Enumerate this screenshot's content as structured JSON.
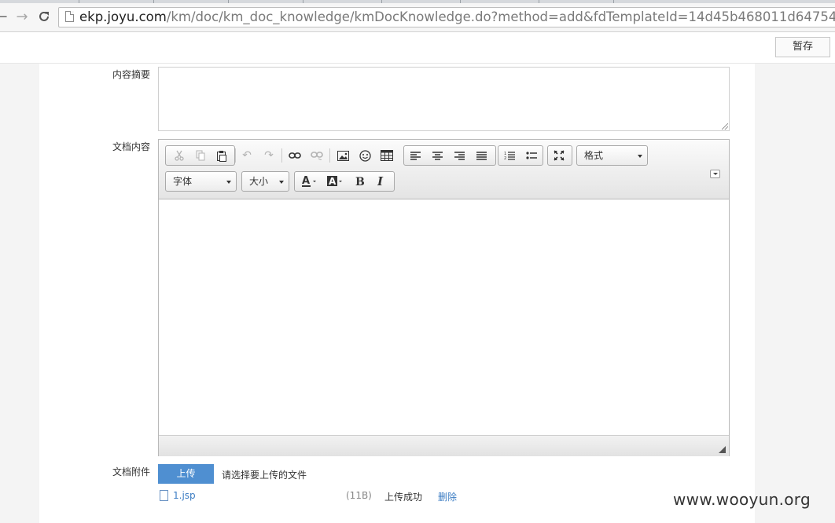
{
  "browser": {
    "url_host": "ekp.joyu.com",
    "url_path": "/km/doc/km_doc_knowledge/kmDocKnowledge.do?method=add&fdTemplateId=14d45b468011d647544a49d4"
  },
  "topbar": {
    "save_draft_label": "暂存"
  },
  "form": {
    "summary_label": "内容摘要",
    "content_label": "文档内容",
    "attachment_label": "文档附件"
  },
  "editor": {
    "format_combo": "格式",
    "font_combo": "字体",
    "size_combo": "大小"
  },
  "attachments": {
    "upload_label": "上传",
    "hint": "请选择要上传的文件",
    "files": [
      {
        "name": "1.jsp",
        "size": "(11B)",
        "status": "上传成功",
        "delete": "删除"
      }
    ]
  },
  "watermark": "www.wooyun.org"
}
